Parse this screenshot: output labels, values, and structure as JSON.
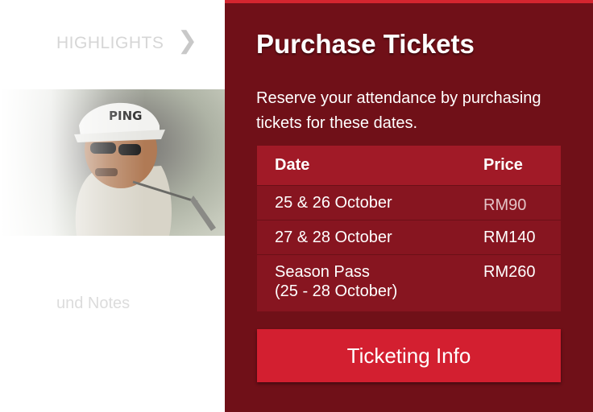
{
  "background": {
    "highlights_label": "HIGHLIGHTS",
    "chevron": "❯",
    "notes_label": "und Notes"
  },
  "panel": {
    "title": "Purchase Tickets",
    "description": "Reserve your attendance by purchasing tickets for these dates.",
    "table": {
      "headers": {
        "date": "Date",
        "price": "Price"
      },
      "rows": [
        {
          "date": "25 & 26 October",
          "price": "RM90"
        },
        {
          "date": "27 & 28 October",
          "price": "RM140"
        },
        {
          "date": "Season Pass",
          "date_line2": "(25 - 28 October)",
          "price": "RM260"
        }
      ]
    },
    "button_label": "Ticketing Info"
  },
  "colors": {
    "panel_bg": "#701018",
    "header_bg": "#a11a27",
    "row_bg": "#871520",
    "button_bg": "#d31f30",
    "accent_line": "#d5252f"
  }
}
